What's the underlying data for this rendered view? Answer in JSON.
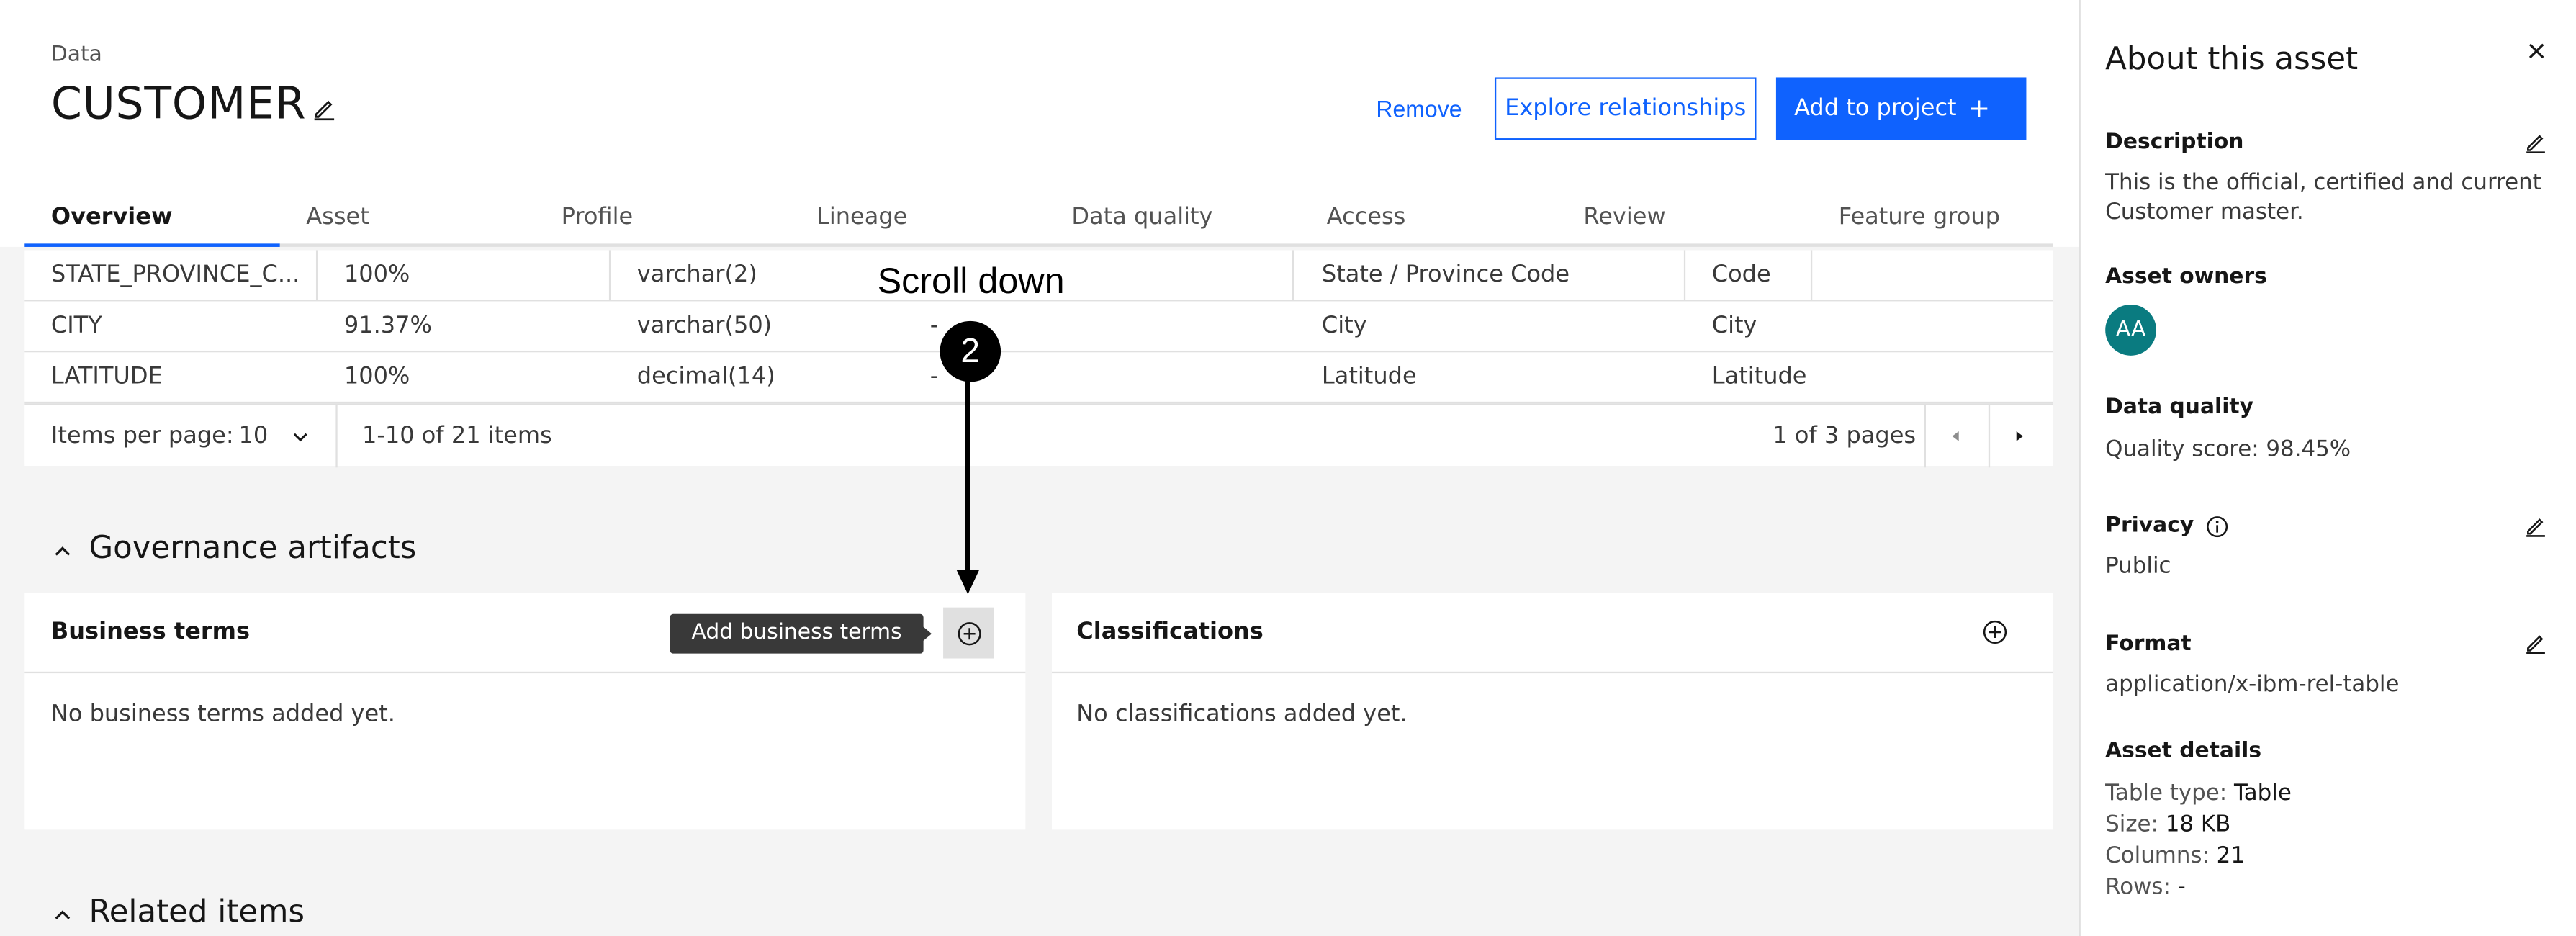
{
  "header": {
    "breadcrumb": "Data",
    "title": "CUSTOMER",
    "remove_label": "Remove",
    "explore_label": "Explore relationships",
    "add_label": "Add to project",
    "add_plus": "+"
  },
  "tabs": [
    {
      "label": "Overview",
      "active": true
    },
    {
      "label": "Asset"
    },
    {
      "label": "Profile"
    },
    {
      "label": "Lineage"
    },
    {
      "label": "Data quality"
    },
    {
      "label": "Access"
    },
    {
      "label": "Review"
    },
    {
      "label": "Feature group"
    }
  ],
  "table": {
    "rows": [
      {
        "name": "STATE_PROVINCE_C...",
        "pct": "100%",
        "type": "varchar(2)",
        "dash": "",
        "label": "State / Province Code",
        "term": "Code"
      },
      {
        "name": "CITY",
        "pct": "91.37%",
        "type": "varchar(50)",
        "dash": "-",
        "label": "City",
        "term": "City"
      },
      {
        "name": "LATITUDE",
        "pct": "100%",
        "type": "decimal(14)",
        "dash": "-",
        "label": "Latitude",
        "term": "Latitude"
      }
    ],
    "pager": {
      "items_per_page_label": "Items per page:",
      "items_per_page_value": "10",
      "range": "1-10 of 21 items",
      "pages": "1 of 3 pages"
    }
  },
  "governance": {
    "heading": "Governance artifacts",
    "business_terms": {
      "title": "Business terms",
      "empty": "No business terms added yet.",
      "tooltip": "Add business terms"
    },
    "classifications": {
      "title": "Classifications",
      "empty": "No classifications added yet."
    }
  },
  "related": {
    "heading": "Related items"
  },
  "annotation": {
    "text": "Scroll down",
    "step": "2"
  },
  "panel": {
    "title": "About this asset",
    "description_label": "Description",
    "description": "This is the official, certified and current Customer master.",
    "owners_label": "Asset owners",
    "owner_initials": "AA",
    "dq_label": "Data quality",
    "dq_value": "Quality score: 98.45%",
    "privacy_label": "Privacy",
    "privacy_value": "Public",
    "format_label": "Format",
    "format_value": "application/x-ibm-rel-table",
    "details_label": "Asset details",
    "details": [
      {
        "key": "Table type:",
        "value": "Table"
      },
      {
        "key": "Size:",
        "value": "18 KB"
      },
      {
        "key": "Columns:",
        "value": "21"
      },
      {
        "key": "Rows:",
        "value": "-"
      }
    ]
  },
  "colors": {
    "accent": "#0f62fe",
    "avatar": "#0a7b80"
  },
  "icons": [
    "edit-icon",
    "chevron-down-icon",
    "chevron-up-icon",
    "caret-left-icon",
    "caret-right-icon",
    "add-circle-icon",
    "close-icon",
    "info-icon"
  ]
}
